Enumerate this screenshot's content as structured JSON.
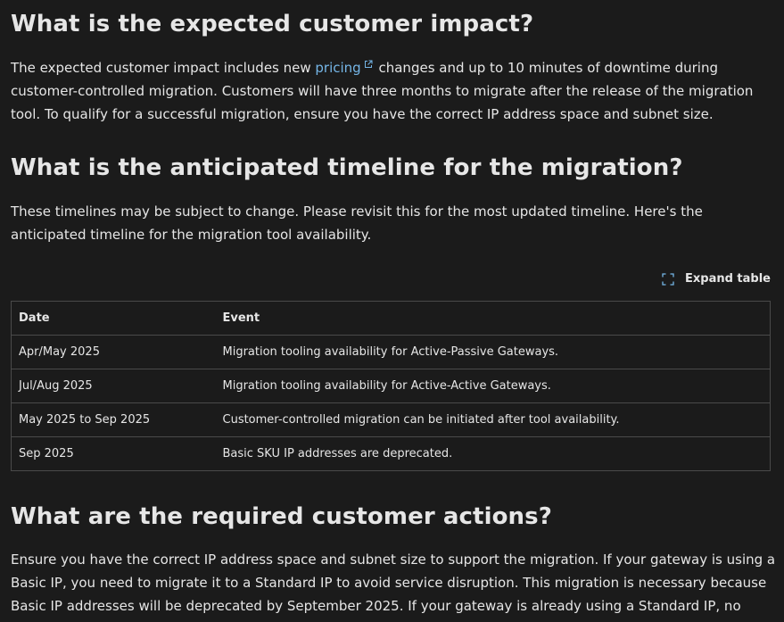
{
  "sections": [
    {
      "heading": "What is the expected customer impact?",
      "paragraph_before_link": "The expected customer impact includes new ",
      "link_text": "pricing",
      "paragraph_after_link": " changes and up to 10 minutes of downtime during customer-controlled migration. Customers will have three months to migrate after the release of the migration tool. To qualify for a successful migration, ensure you have the correct IP address space and subnet size."
    },
    {
      "heading": "What is the anticipated timeline for the migration?",
      "paragraph": "These timelines may be subject to change. Please revisit this for the most updated timeline. Here's the anticipated timeline for the migration tool availability."
    },
    {
      "heading": "What are the required customer actions?",
      "paragraph": "Ensure you have the correct IP address space and subnet size to support the migration. If your gateway is using a Basic IP, you need to migrate it to a Standard IP to avoid service disruption. This migration is necessary because Basic IP addresses will be deprecated by September 2025. If your gateway is already using a Standard IP, no action is required."
    }
  ],
  "expand_table_label": "Expand table",
  "table": {
    "headers": [
      "Date",
      "Event"
    ],
    "rows": [
      [
        "Apr/May 2025",
        "Migration tooling availability for Active-Passive Gateways."
      ],
      [
        "Jul/Aug 2025",
        "Migration tooling availability for Active-Active Gateways."
      ],
      [
        "May 2025 to Sep 2025",
        "Customer-controlled migration can be initiated after tool availability."
      ],
      [
        "Sep 2025",
        "Basic SKU IP addresses are deprecated."
      ]
    ]
  },
  "colors": {
    "background": "#1b1b1b",
    "text": "#e6e6e6",
    "link": "#75b6e7",
    "border": "#4a4a4a"
  },
  "icons": {
    "external_link": "external-link-icon",
    "expand": "expand-icon"
  }
}
